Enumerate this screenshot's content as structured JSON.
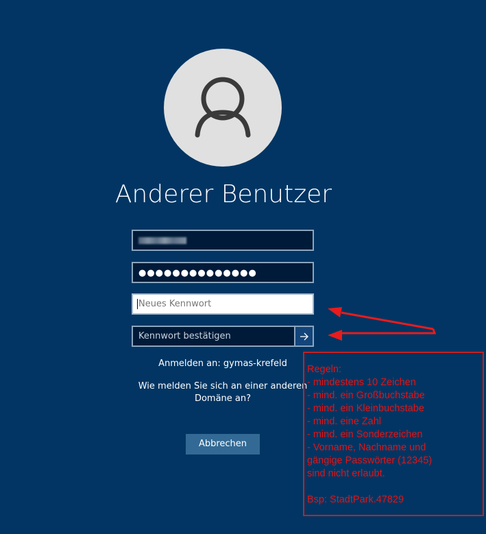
{
  "login": {
    "user_title": "Anderer Benutzer",
    "password_mask": "●●●●●●●●●●●●●●",
    "new_password_placeholder": "Neues Kennwort",
    "confirm_password_placeholder": "Kennwort bestätigen",
    "sign_in_to": "Anmelden an: gymas-krefeld",
    "other_domain_line1": "Wie melden Sie sich an einer anderen",
    "other_domain_line2": "Domäne an?",
    "cancel_label": "Abbrechen"
  },
  "icons": {
    "avatar": "user-silhouette",
    "submit": "arrow-right"
  },
  "annotation": {
    "rules": [
      "Regeln:",
      "- mindestens 10 Zeichen",
      "- mind. ein Großbuchstabe",
      "- mind. ein Kleinbuchstabe",
      "- mind. eine Zahl",
      "- mind. ein Sonderzeichen",
      "- Vorname, Nachname und",
      "gängige Passwörter (12345)",
      "sind nicht erlaubt.",
      "",
      "Bsp: StadtPark.47829"
    ],
    "color": "#e31414"
  },
  "colors": {
    "background": "#023563",
    "field_background": "#001b39",
    "cancel_button": "#336a95"
  }
}
